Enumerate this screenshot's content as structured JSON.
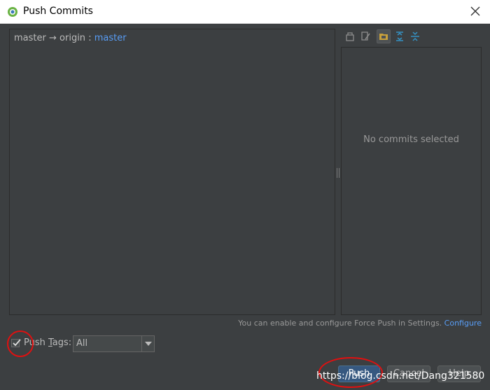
{
  "window": {
    "title": "Push Commits",
    "app_icon": "android-studio-icon",
    "close_icon": "close-icon"
  },
  "branch": {
    "local": "master",
    "arrow": "→",
    "remote": "origin",
    "separator": ":",
    "remote_branch": "master"
  },
  "details": {
    "empty_text": "No commits selected"
  },
  "toolbar": {
    "icons": [
      "commit-details-icon",
      "edit-source-icon",
      "group-by-directory-icon",
      "expand-all-icon",
      "collapse-all-icon"
    ],
    "active_icon": "group-by-directory-icon"
  },
  "force_push": {
    "hint": "You can enable and configure Force Push in Settings.",
    "link": "Configure"
  },
  "push_tags": {
    "label_pre": "Push ",
    "label_mnemonic": "T",
    "label_post": "ags:",
    "checked": true,
    "selected": "All"
  },
  "buttons": {
    "push": "Push",
    "cancel": "Cancel",
    "help": "Help"
  },
  "watermark": "https://blog.csdn.net/Dang321580",
  "colors": {
    "background": "#3c3f41",
    "link": "#589df6",
    "annotation": "#e01010",
    "default_button": "#365880"
  }
}
